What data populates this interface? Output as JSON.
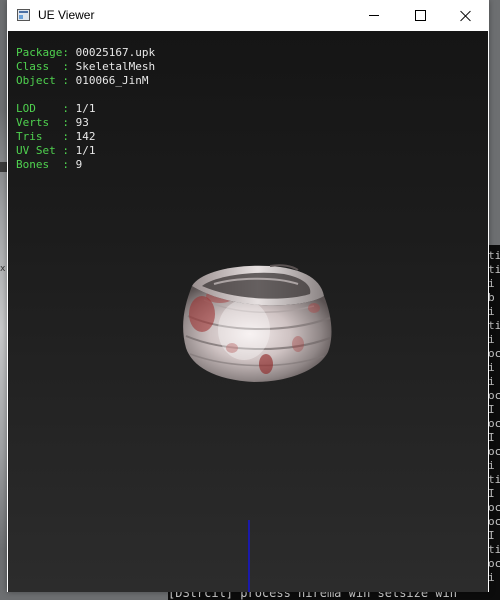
{
  "window": {
    "title": "UE Viewer",
    "icon": "app-window-icon",
    "controls": {
      "minimize": "minimize-icon",
      "maximize": "maximize-icon",
      "close": "close-icon"
    }
  },
  "info": {
    "package_label": "Package:",
    "package_value": "00025167.upk",
    "class_label": "Class  :",
    "class_value": "SkeletalMesh",
    "object_label": "Object :",
    "object_value": "010066_JinM",
    "lod_label": "LOD    :",
    "lod_value": "1/1",
    "verts_label": "Verts  :",
    "verts_value": "93",
    "tris_label": "Tris   :",
    "tris_value": "142",
    "uvset_label": "UV Set :",
    "uvset_value": "1/1",
    "bones_label": "Bones  :",
    "bones_value": "9"
  },
  "background": {
    "console_bottom_text": "[DStrcil] process  hirema win setsize  win",
    "console_side_chars": [
      "ti",
      "ti",
      "i",
      "b",
      "i",
      "ti",
      "i",
      "oc",
      "i",
      "i",
      "oc",
      "I",
      "oc",
      "I",
      "oc",
      "i",
      "ti",
      "I",
      "oc",
      "oc",
      "I",
      "ti",
      "oc",
      "i",
      "b"
    ]
  },
  "colors": {
    "label_green": "#4fd24f",
    "value_white": "#e8e8e8",
    "axis_blue": "#1a1aaa"
  }
}
